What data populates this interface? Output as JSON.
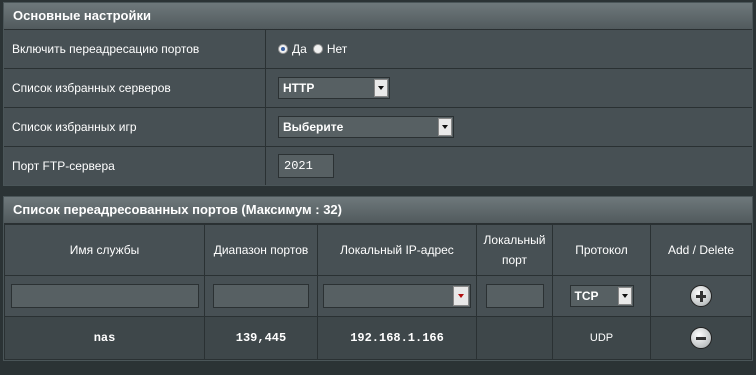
{
  "basic": {
    "title": "Основные настройки",
    "port_forward_label": "Включить переадресацию портов",
    "radio_yes": "Да",
    "radio_no": "Нет",
    "fav_servers_label": "Список избранных серверов",
    "fav_servers_value": "HTTP",
    "fav_games_label": "Список избранных игр",
    "fav_games_value": "Выберите",
    "ftp_label": "Порт FTP-сервера",
    "ftp_value": "2021"
  },
  "forwarded": {
    "title": "Список переадресованных портов (Максимум : 32)",
    "headers": {
      "service": "Имя службы",
      "range": "Диапазон портов",
      "local_ip": "Локальный IP-адрес",
      "local_port": "Локальный порт",
      "protocol": "Протокол",
      "add_delete": "Add / Delete"
    },
    "input_protocol": "TCP",
    "rows": [
      {
        "service": "nas",
        "range": "139,445",
        "ip": "192.168.1.166",
        "port": "",
        "protocol": "UDP"
      }
    ]
  },
  "colors": {
    "panel": "#475054",
    "background": "#2b3335",
    "header": "#6e787b"
  }
}
